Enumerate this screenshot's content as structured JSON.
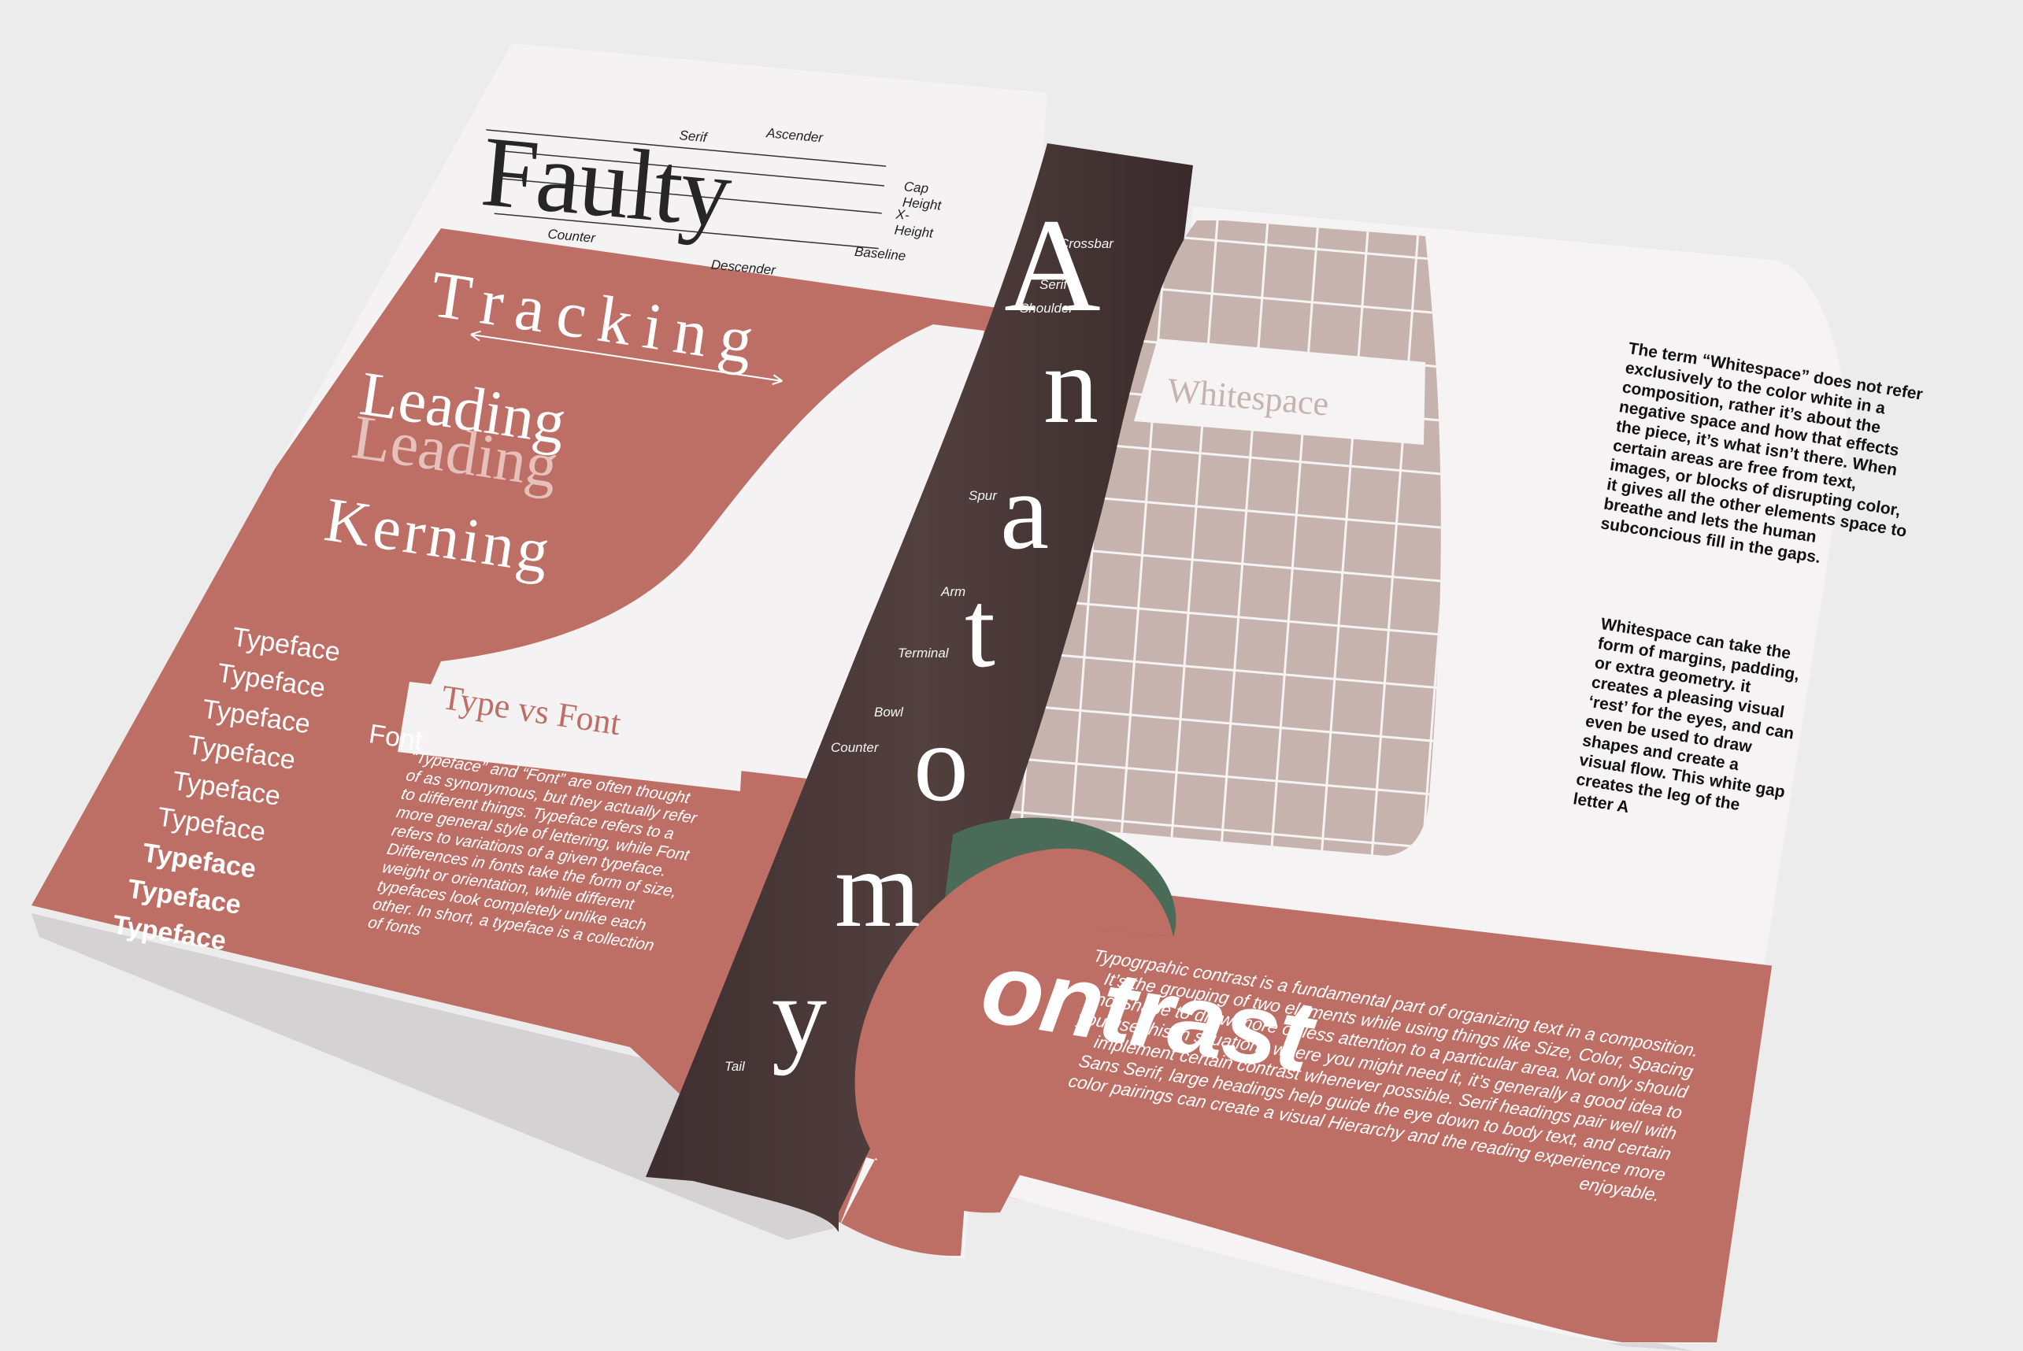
{
  "colors": {
    "background": "#ececec",
    "paper": "#f5f3f3",
    "terracotta": "#bd6f66",
    "spine_brown": "#4b3738",
    "grid_mauve": "#c7b3ae",
    "green": "#4a6b57"
  },
  "anatomy_diagram": {
    "word": "Faulty",
    "labels": [
      "Ascender",
      "Serif",
      "Cap Height",
      "X-Height",
      "Counter",
      "Descender",
      "Baseline"
    ]
  },
  "spacing_terms": {
    "tracking": "Tracking",
    "leading_1": "Leading",
    "leading_2": "Leading",
    "kerning": "Kerning"
  },
  "typeface_list": {
    "items": [
      "Typeface",
      "Typeface",
      "Typeface",
      "Typeface",
      "Typeface",
      "Typeface",
      "Typeface",
      "Typeface",
      "Typeface"
    ],
    "font_label": "Font"
  },
  "type_vs_font": {
    "heading": "Type vs Font",
    "paragraph": "“Typeface” and “Font” are often thought of as synonymous, but they actually refer to different things. Typeface refers to a more general style of lettering, while Font refers to variations of a given typeface. Differences in fonts take the form of size, weight or orientation, while different typefaces look completely unlike each other. In short, a typeface is a collection of fonts"
  },
  "anatomy_spine": {
    "letters": [
      "A",
      "n",
      "a",
      "t",
      "o",
      "m",
      "y"
    ],
    "labels": [
      "Crossbar",
      "Serif",
      "Shoulder",
      "Spur",
      "Arm",
      "Terminal",
      "Bowl",
      "Counter",
      "Tail"
    ]
  },
  "whitespace": {
    "heading": "Whitespace",
    "paragraph_1": "The term “Whitespace” does not refer exclusively to the color white in a composition, rather it’s about the negative space and how that effects the piece, it’s what isn’t there. When certain areas are free from text, images, or blocks of disrupting color, it gives all the other elements space to breathe and lets the human subconcious fill in the gaps.",
    "paragraph_2": "Whitespace can take the form of margins, padding, or extra geometry. it creates a pleasing visual ‘rest’ for the eyes, and can even be used to draw shapes and create a visual flow. This white gap creates the leg of the letter A"
  },
  "contrast": {
    "heading_rest": "ontrast",
    "paragraph": "Typogrpahic contrast is a fundamental part of organizing text in a composition. It’s the grouping of two elements while using things like Size, Color, Spacing and Shape to draw more or less attention to a particular area. Not only should you use this in situations where you might need it, it’s generally a good idea to implement certain contrast whenever possible. Serif headings pair well with Sans Serif, large headings help guide the eye down to body text, and certain color pairings can create a visual Hierarchy and the reading experience more enjoyable."
  }
}
